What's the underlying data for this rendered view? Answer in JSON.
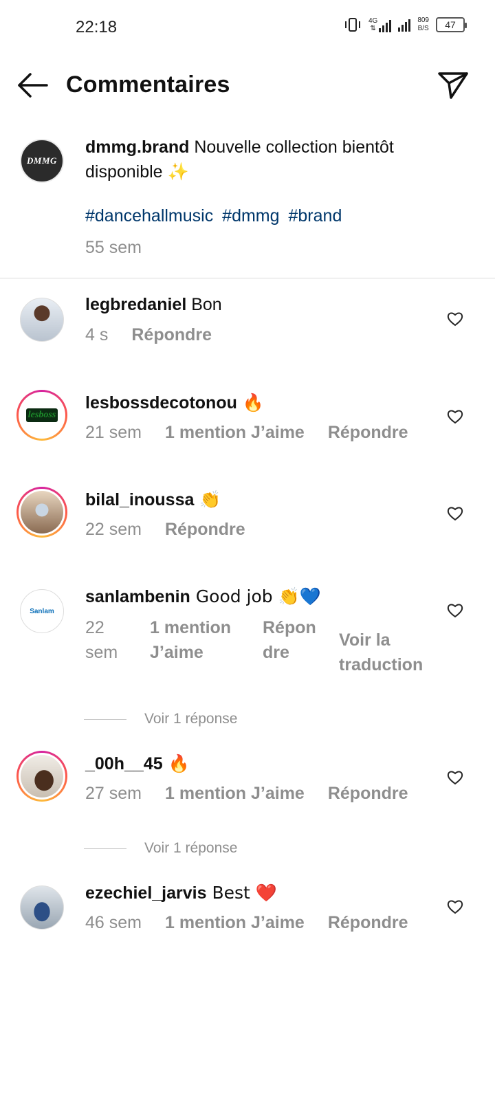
{
  "status_bar": {
    "time": "22:18",
    "network_label": "4G",
    "speed_value": "809",
    "speed_unit": "B/S",
    "battery": "47"
  },
  "header": {
    "title": "Commentaires",
    "back_icon": "arrow-left",
    "share_icon": "paper-plane"
  },
  "caption": {
    "username": "dmmg.brand",
    "text": " Nouvelle collection bientôt disponible ✨",
    "avatar_logo_text": "DMMG",
    "hashtags": [
      "#dancehallmusic",
      "#dmmg",
      "#brand"
    ],
    "time": "55 sem"
  },
  "comments": [
    {
      "username": "legbredaniel",
      "text": " Bon",
      "time": "4 s",
      "likes": "",
      "reply": "Répondre",
      "translate": ""
    },
    {
      "username": "lesbossdecotonou",
      "text": " 🔥",
      "time": "21 sem",
      "likes": "1 mention J’aime",
      "reply": "Répondre",
      "translate": "",
      "avatar_text": "lesboss"
    },
    {
      "username": "bilal_inoussa",
      "text": " 👏",
      "time": "22 sem",
      "likes": "",
      "reply": "Répondre",
      "translate": ""
    },
    {
      "username": "sanlambenin",
      "text": " Good job 👏💙",
      "time": "22 sem",
      "likes": "1 mention J’aime",
      "reply": "Répondre",
      "translate": "Voir la traduction",
      "avatar_text": "Sanlam"
    },
    {
      "username": "_00h__45",
      "text": " 🔥",
      "time": "27 sem",
      "likes": "1 mention J’aime",
      "reply": "Répondre",
      "translate": ""
    },
    {
      "username": "ezechiel_jarvis",
      "text": " Best ❤️",
      "time": "46 sem",
      "likes": "1 mention J’aime",
      "reply": "Répondre",
      "translate": ""
    }
  ],
  "view_replies": [
    "Voir 1 réponse",
    "Voir 1 réponse"
  ],
  "colors": {
    "hashtag": "#00376b",
    "secondary_text": "#8e8e8e",
    "story_ring": [
      "#d6249f",
      "#fd5949",
      "#fdbb3b"
    ]
  }
}
